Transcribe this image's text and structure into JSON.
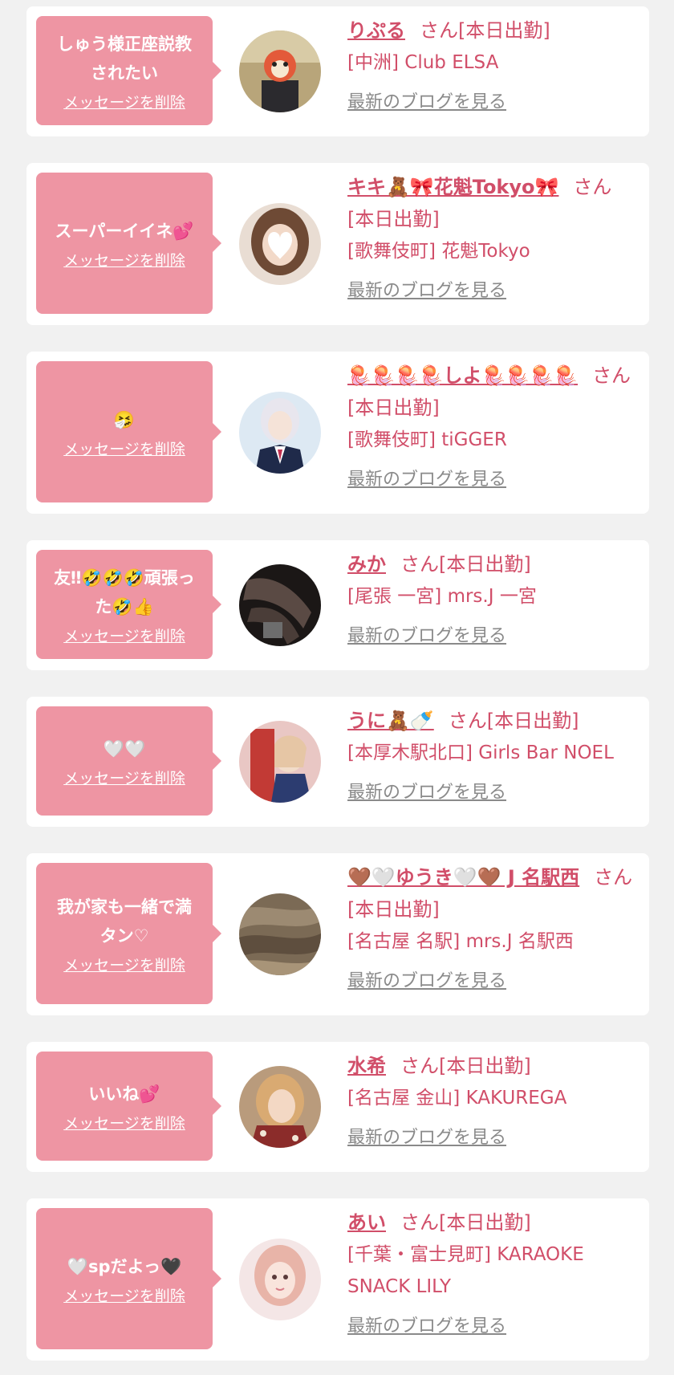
{
  "delete_label": "メッセージを削除",
  "blog_label": "最新のブログを見る",
  "colors": {
    "page_bg": "#f1f1f1",
    "bubble": "#ee95a3",
    "accent_text": "#d14e69",
    "blog_link": "#8a8a8a"
  },
  "entries": [
    {
      "message": "しゅう様正座説教\nされたい",
      "name": "りぷる",
      "status": "さん[本日出勤]",
      "shop": "[中洲] Club ELSA",
      "avatar": "face-with-mask-avatar"
    },
    {
      "message": "スーパーイイネ💕",
      "name": "キキ🧸🎀花魁Tokyo🎀",
      "status": "さん[本日出勤]",
      "shop": "[歌舞伎町] 花魁Tokyo",
      "avatar": "brown-hair-avatar"
    },
    {
      "message": "🤧",
      "name": "🪼🪼🪼🪼しよ🪼🪼🪼🪼",
      "status": "さん[本日出勤]",
      "shop": "[歌舞伎町] tiGGER",
      "avatar": "uniform-avatar"
    },
    {
      "message": "友‼︎🤣🤣🤣頑張っ\nた🤣👍",
      "name": "みか",
      "status": "さん[本日出勤]",
      "shop": "[尾張 一宮] mrs.J 一宮",
      "avatar": "legs-avatar"
    },
    {
      "message": "🤍🤍",
      "name": "うに🧸🍼",
      "status": "さん[本日出勤]",
      "shop": "[本厚木駅北口] Girls Bar NOEL",
      "avatar": "red-post-avatar"
    },
    {
      "message": "我が家も一緒で満\nタン♡",
      "name": "🤎🤍ゆうき🤍🤎 J 名駅西",
      "status": "さん[本日出勤]",
      "shop": "[名古屋 名駅] mrs.J 名駅西",
      "avatar": "hair-closeup-avatar"
    },
    {
      "message": "いいね💕",
      "name": "水希",
      "status": "さん[本日出勤]",
      "shop": "[名古屋 金山] KAKUREGA",
      "avatar": "selfie-avatar"
    },
    {
      "message": "🤍spだよっ🖤",
      "name": "あい",
      "status": "さん[本日出勤]",
      "shop": "[千葉・富士見町] KARAOKE SNACK LILY",
      "avatar": "pink-selfie-avatar"
    }
  ]
}
